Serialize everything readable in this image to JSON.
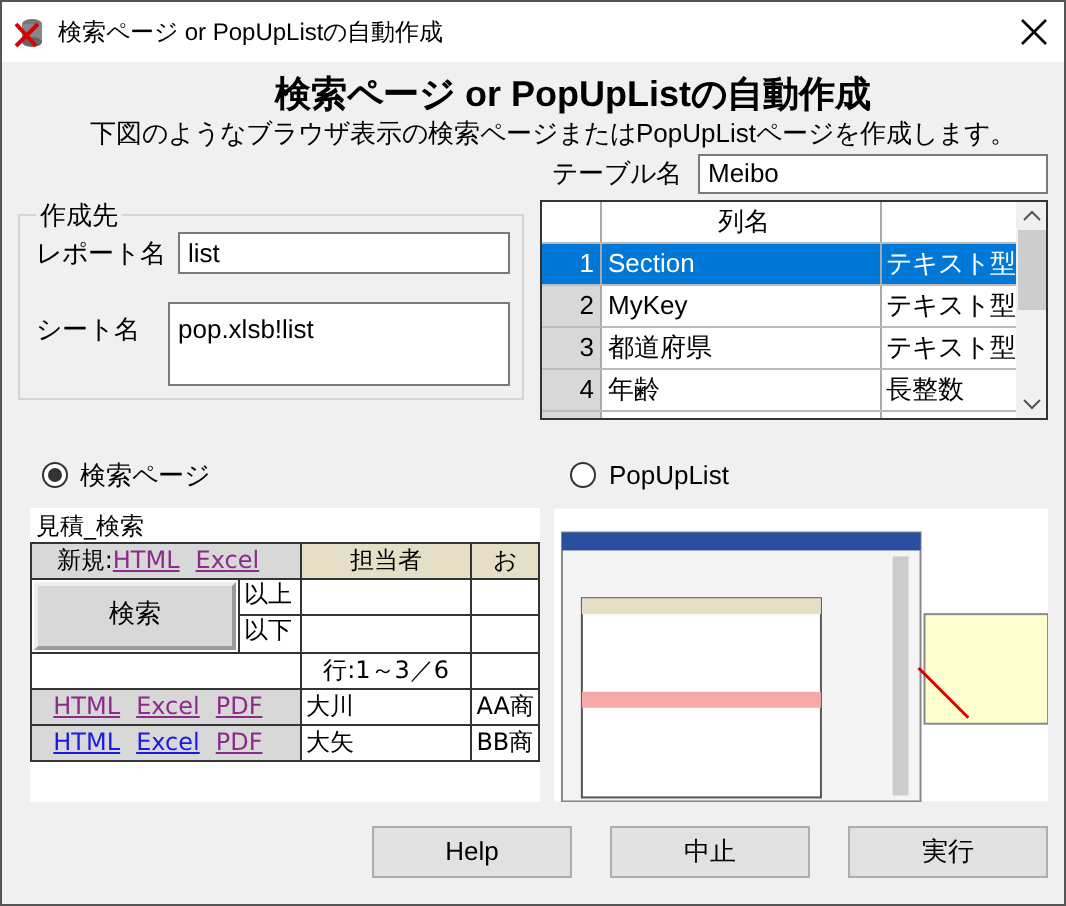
{
  "window": {
    "title": "検索ページ or PopUpListの自動作成"
  },
  "heading": "検索ページ or PopUpListの自動作成",
  "description": "下図のようなブラウザ表示の検索ページまたはPopUpListページを作成します。",
  "table_name": {
    "label": "テーブル名",
    "value": "Meibo"
  },
  "column_grid": {
    "header": "列名",
    "rows": [
      {
        "number": "1",
        "name": "Section",
        "type": "テキスト型",
        "selected": true
      },
      {
        "number": "2",
        "name": "MyKey",
        "type": "テキスト型",
        "selected": false
      },
      {
        "number": "3",
        "name": "都道府県",
        "type": "テキスト型",
        "selected": false
      },
      {
        "number": "4",
        "name": "年齢",
        "type": "長整数",
        "selected": false
      }
    ]
  },
  "destination": {
    "legend": "作成先",
    "report": {
      "label": "レポート名",
      "value": "list"
    },
    "sheet": {
      "label": "シート名",
      "value": "pop.xlsb!list"
    }
  },
  "modes": [
    {
      "label": "検索ページ",
      "selected": true
    },
    {
      "label": "PopUpList",
      "selected": false
    }
  ],
  "search_preview": {
    "title": "見積_検索",
    "new_label": "新規:",
    "new_links": [
      {
        "text": "HTML",
        "visited": true
      },
      {
        "text": "Excel",
        "visited": true
      }
    ],
    "columns": [
      "担当者",
      "お"
    ],
    "search_button": "検索",
    "range": [
      "以上",
      "以下"
    ],
    "row_count": "行:1～3／6",
    "rows": [
      {
        "links": [
          {
            "text": "HTML",
            "visited": true
          },
          {
            "text": "Excel",
            "visited": true
          },
          {
            "text": "PDF",
            "visited": true
          }
        ],
        "cells": [
          "大川",
          "AA商"
        ]
      },
      {
        "links": [
          {
            "text": "HTML",
            "visited": false
          },
          {
            "text": "Excel",
            "visited": false
          },
          {
            "text": "PDF",
            "visited": true
          }
        ],
        "cells": [
          "大矢",
          "BB商"
        ]
      }
    ]
  },
  "buttons": [
    "Help",
    "中止",
    "実行"
  ]
}
